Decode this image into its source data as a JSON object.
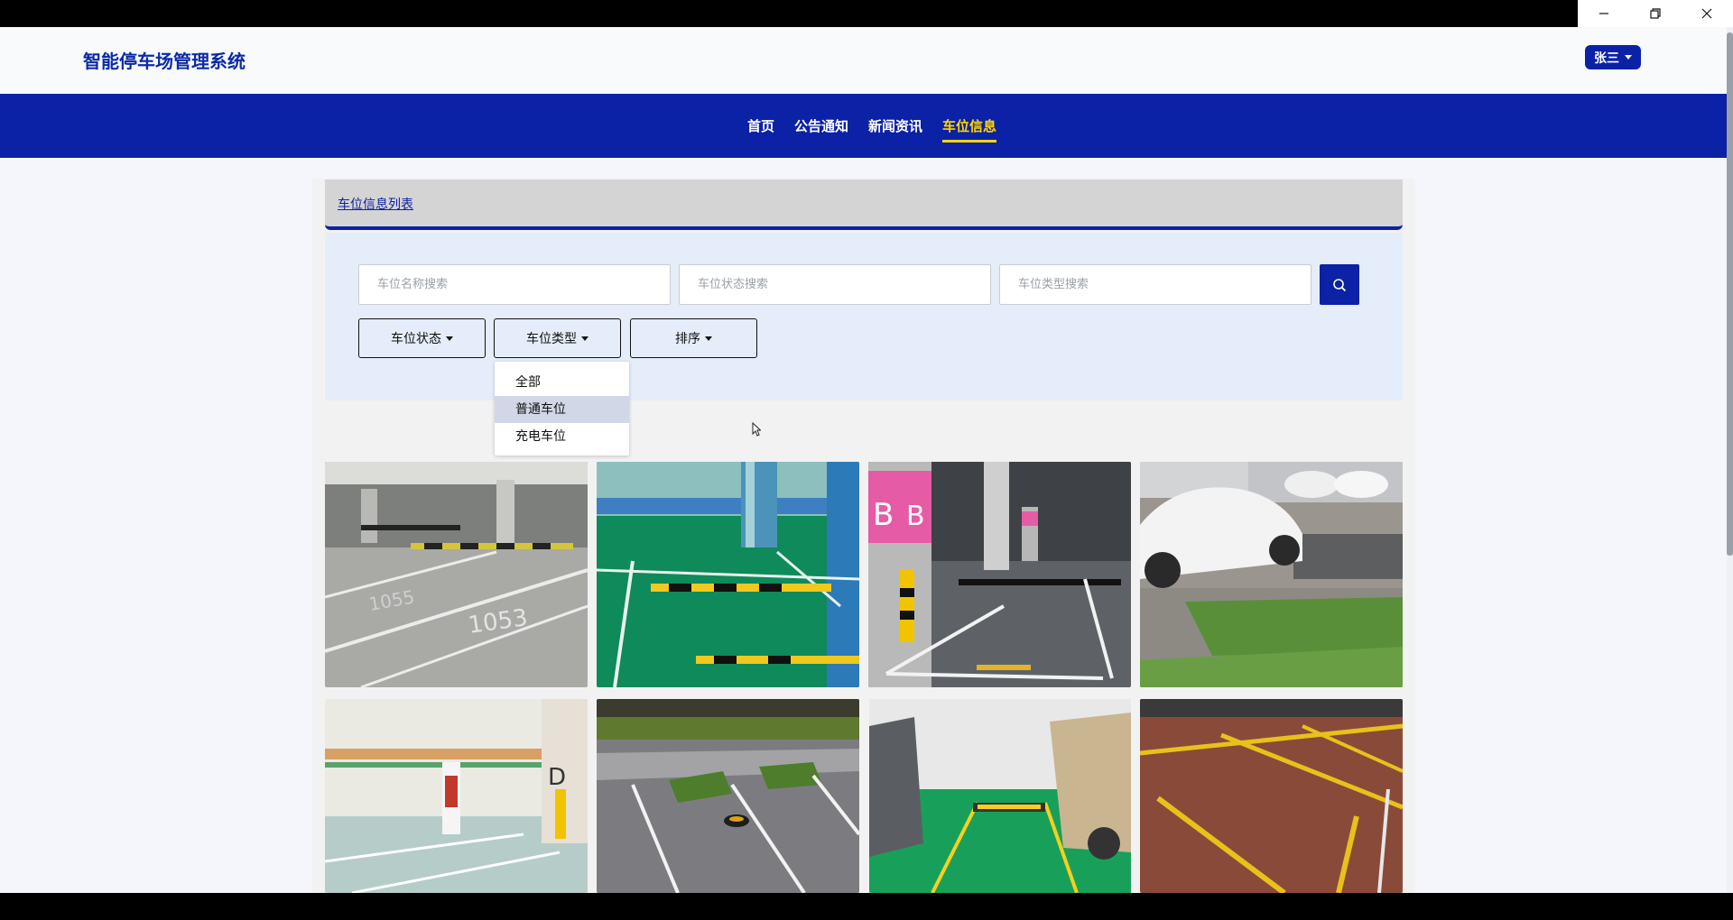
{
  "site": {
    "title": "智能停车场管理系统"
  },
  "user": {
    "name": "张三"
  },
  "nav": {
    "items": [
      {
        "label": "首页"
      },
      {
        "label": "公告通知"
      },
      {
        "label": "新闻资讯"
      },
      {
        "label": "车位信息"
      }
    ],
    "active_index": 3
  },
  "panel": {
    "title": "车位信息列表"
  },
  "search": {
    "name_placeholder": "车位名称搜索",
    "status_placeholder": "车位状态搜索",
    "type_placeholder": "车位类型搜索"
  },
  "filters": {
    "status_label": "车位状态",
    "type_label": "车位类型",
    "sort_label": "排序"
  },
  "dropdown": {
    "items": [
      {
        "label": "全部"
      },
      {
        "label": "普通车位"
      },
      {
        "label": "充电车位"
      }
    ],
    "hovered_index": 1
  },
  "cards": [
    {
      "image": "underground-parking-grey"
    },
    {
      "image": "green-epoxy-parking"
    },
    {
      "image": "pink-pillar-parking"
    },
    {
      "image": "outdoor-grass-parking-car"
    },
    {
      "image": "ev-charging-parking"
    },
    {
      "image": "outdoor-paver-parking"
    },
    {
      "image": "green-parking-spot-cars"
    },
    {
      "image": "red-brick-yellow-lines"
    }
  ],
  "colors": {
    "brand": "#0b21a6",
    "active_nav": "#ffd600",
    "search_panel": "#e4edf9"
  }
}
